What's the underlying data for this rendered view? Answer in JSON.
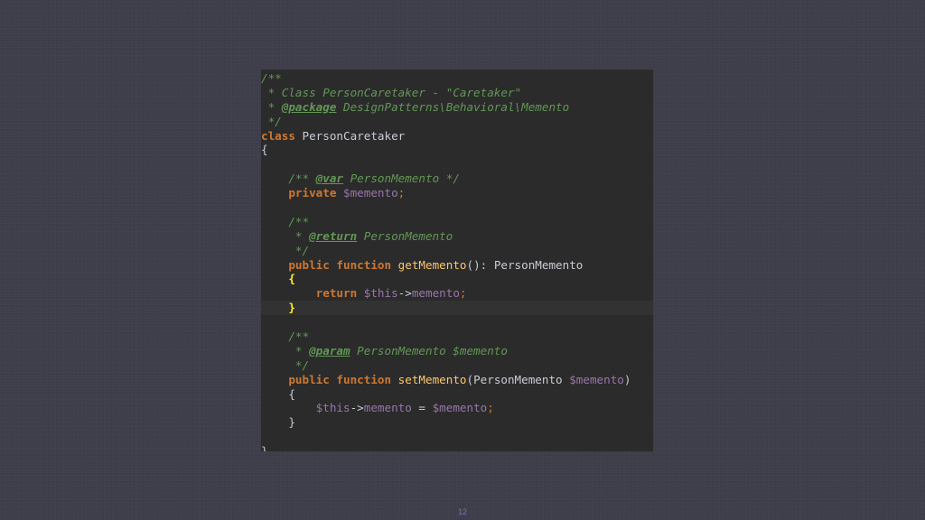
{
  "code": {
    "l1": "/**",
    "l2_star": " * ",
    "l2_text": "Class PersonCaretaker - \"Caretaker\"",
    "l3_star": " * ",
    "l3_tag": "@package",
    "l3_text": " DesignPatterns\\Behavioral\\Memento",
    "l4": " */",
    "l5_kw": "class",
    "l5_name": " PersonCaretaker",
    "l6": "{",
    "l8_open": "    /** ",
    "l8_tag": "@var",
    "l8_type": " PersonMemento */",
    "l9_kw": "    private ",
    "l9_var": "$memento",
    "l9_semi": ";",
    "l11": "    /**",
    "l12_star": "     * ",
    "l12_tag": "@return",
    "l12_text": " PersonMemento",
    "l13": "     */",
    "l14_kw": "    public function ",
    "l14_fn": "getMemento",
    "l14_rest": "(): PersonMemento",
    "l15_indent": "    ",
    "l15_brace": "{",
    "l16_kw": "        return ",
    "l16_this": "$this",
    "l16_arrow": "->",
    "l16_prop": "memento",
    "l16_semi": ";",
    "l17_indent": "    ",
    "l17_brace": "}",
    "l19": "    /**",
    "l20_star": "     * ",
    "l20_tag": "@param",
    "l20_text": " PersonMemento $memento",
    "l21": "     */",
    "l22_kw": "    public function ",
    "l22_fn": "setMemento",
    "l22_open": "(PersonMemento ",
    "l22_var": "$memento",
    "l22_close": ")",
    "l23": "    {",
    "l24_this": "        $this",
    "l24_arrow": "->",
    "l24_prop": "memento",
    "l24_eq": " = ",
    "l24_var": "$memento",
    "l24_semi": ";",
    "l25": "    }",
    "l27": "}"
  },
  "page": {
    "number": "12"
  },
  "colors": {
    "background": "#3e3e4a",
    "editor_bg": "#2b2b2b",
    "doc_comment": "#629755",
    "keyword": "#cc7832",
    "variable": "#9876aa",
    "function": "#ffc66d",
    "brace_highlight": "#ffef28"
  }
}
